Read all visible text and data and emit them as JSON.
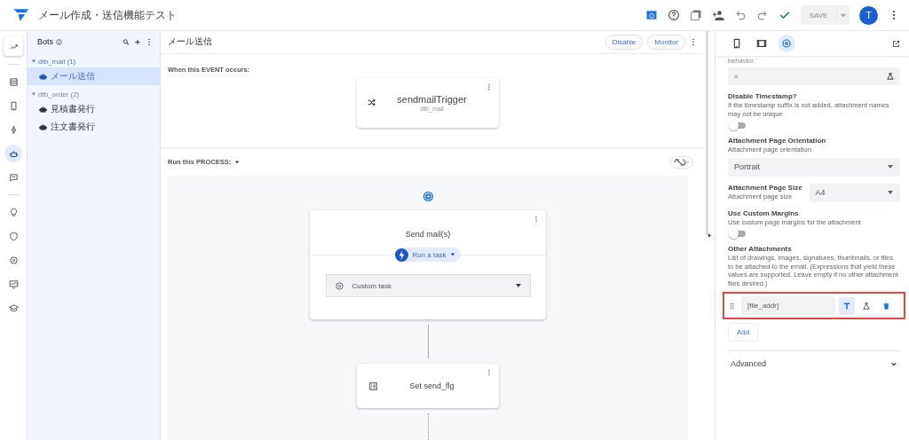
{
  "header": {
    "title": "メール作成・送信機能テスト",
    "save_label": "SAVE",
    "avatar_letter": "T"
  },
  "rail": [
    {
      "selected": false
    },
    {
      "selected": false
    },
    {
      "selected": false
    },
    {
      "selected": false
    },
    {
      "selected": true
    },
    {
      "selected": false
    },
    {
      "selected": false
    },
    {
      "selected": false
    },
    {
      "selected": false
    },
    {
      "selected": false
    },
    {
      "selected": false
    }
  ],
  "bots_panel": {
    "title": "Bots",
    "groups": [
      {
        "name": "dtb_mail (1)",
        "expanded": true,
        "bots": [
          {
            "name": "メール送信",
            "selected": true
          }
        ]
      },
      {
        "name": "dtb_order (2)",
        "expanded": true,
        "bots": [
          {
            "name": "見積書発行",
            "selected": false
          },
          {
            "name": "注文書発行",
            "selected": false
          }
        ]
      }
    ]
  },
  "editor": {
    "title": "メール送信",
    "buttons": [
      "Disable",
      "Monitor"
    ],
    "event_label": "When this EVENT occurs:",
    "trigger": {
      "name": "sendmailTrigger",
      "table": "dtb_mail"
    },
    "process_label": "Run this PROCESS:",
    "steps": [
      {
        "kind": "task",
        "title": "Send mail(s)",
        "chip": "Run a task",
        "task": "Custom task"
      },
      {
        "kind": "data",
        "title": "Set send_flg"
      }
    ]
  },
  "properties": {
    "tabs": [
      {
        "selected": false
      },
      {
        "selected": false
      },
      {
        "selected": true
      }
    ],
    "cut_text": "behavior.",
    "expression": "=",
    "timestamp": {
      "label": "Disable Timestamp?",
      "help": "If the timestamp suffix is not added, attachment names may not be unique",
      "on": false
    },
    "orientation": {
      "label": "Attachment Page Orientation",
      "help": "Attachment page orientation",
      "value": "Portrait"
    },
    "size": {
      "label": "Attachment Page Size",
      "help": "Attachment page size",
      "value": "A4"
    },
    "margins": {
      "label": "Use Custom Margins",
      "help": "Use custom page margins for the attachment",
      "on": false
    },
    "attachments": {
      "label": "Other Attachments",
      "help": "List of drawings, images, signatures, thumbnails, or files to be attached to the email. (Expressions that yield these values are supported. Leave empty if no other attachment files desired.)",
      "items": [
        {
          "value": "[file_addr]",
          "text_mode": true
        }
      ],
      "add_label": "Add"
    },
    "advanced": {
      "label": "Advanced",
      "expanded": false
    }
  }
}
